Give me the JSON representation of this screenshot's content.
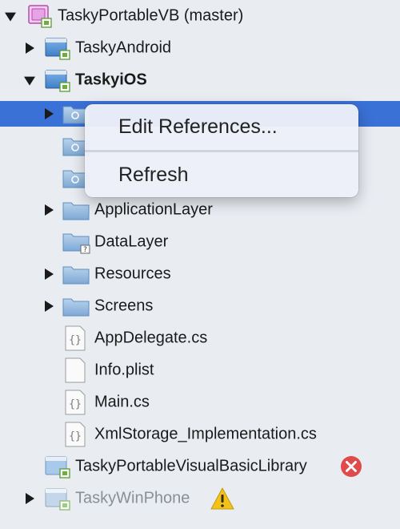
{
  "tree": {
    "items": [
      {
        "label": "TaskyPortableVB (master)",
        "icon": "solution-icon",
        "expanded": true
      },
      {
        "label": "TaskyAndroid",
        "icon": "project-icon",
        "expanded": false
      },
      {
        "label": "TaskyiOS",
        "icon": "project-icon",
        "expanded": true,
        "bold": true
      },
      {
        "label": "",
        "icon": "special-folder-icon",
        "selected": true
      },
      {
        "label": "",
        "icon": "special-folder-icon"
      },
      {
        "label": "",
        "icon": "special-folder-icon"
      },
      {
        "label": "ApplicationLayer",
        "icon": "folder-icon",
        "expanded": false
      },
      {
        "label": "DataLayer",
        "icon": "folder-missing-icon"
      },
      {
        "label": "Resources",
        "icon": "folder-icon",
        "expanded": false
      },
      {
        "label": "Screens",
        "icon": "folder-icon",
        "expanded": false
      },
      {
        "label": "AppDelegate.cs",
        "icon": "csharp-file-icon"
      },
      {
        "label": "Info.plist",
        "icon": "file-icon"
      },
      {
        "label": "Main.cs",
        "icon": "csharp-file-icon"
      },
      {
        "label": "XmlStorage_Implementation.cs",
        "icon": "csharp-file-icon"
      },
      {
        "label": "TaskyPortableVisualBasicLibrary",
        "icon": "project-icon",
        "status": "error-icon"
      },
      {
        "label": "TaskyWinPhone",
        "icon": "project-icon",
        "expanded": false,
        "disabled": true,
        "status": "warning-icon"
      }
    ]
  },
  "context_menu": {
    "items": [
      {
        "label": "Edit References..."
      },
      {
        "label": "Refresh"
      }
    ]
  },
  "colors": {
    "background": "#e9edf2",
    "selection": "#3a71d6",
    "error": "#e04a4a",
    "warning": "#f2c21b"
  }
}
